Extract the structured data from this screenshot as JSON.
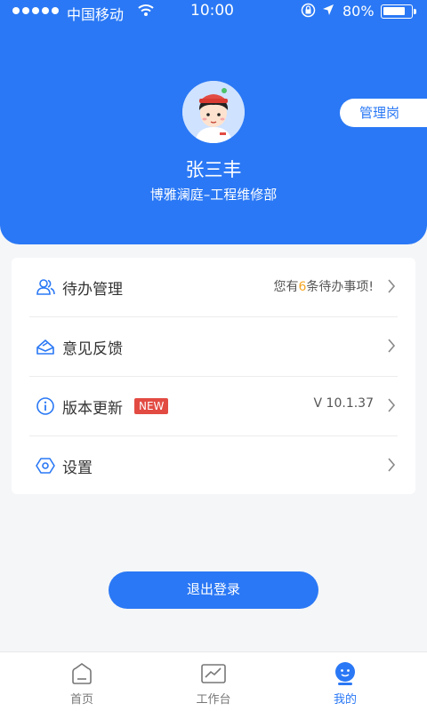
{
  "status_bar": {
    "carrier": "中国移动",
    "time": "10:00",
    "battery": "80%"
  },
  "profile": {
    "name": "张三丰",
    "department": "博雅澜庭–工程维修部",
    "role": "管理岗"
  },
  "menu": {
    "todo": {
      "label": "待办管理",
      "prefix": "您有",
      "count": "6",
      "suffix": "条待办事项!"
    },
    "feedback": {
      "label": "意见反馈"
    },
    "update": {
      "label": "版本更新",
      "badge": "NEW",
      "version": "V 10.1.37"
    },
    "settings": {
      "label": "设置"
    }
  },
  "logout_label": "退出登录",
  "tabbar": {
    "home": "首页",
    "workbench": "工作台",
    "mine": "我的",
    "active": "mine"
  },
  "colors": {
    "primary": "#2a78f5",
    "badge": "#e24b42",
    "highlight": "#f5a623"
  }
}
